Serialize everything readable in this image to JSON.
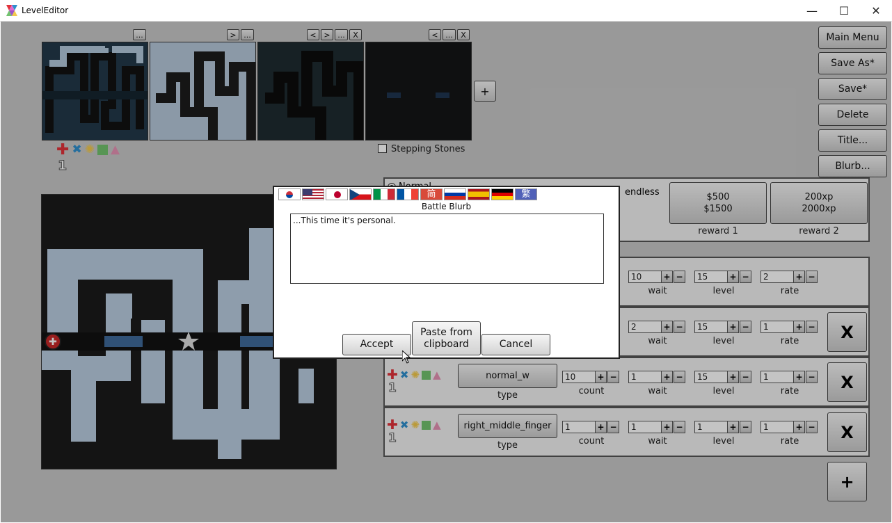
{
  "window": {
    "title": "LevelEditor",
    "minimize": "—",
    "maximize": "☐",
    "close": "✕"
  },
  "thumbs": {
    "buttons": [
      "...",
      ">",
      "...",
      "<",
      ">",
      "...",
      "X",
      "<",
      "...",
      "X"
    ],
    "add": "+",
    "stepping_stones": "Stepping Stones",
    "number": "1"
  },
  "sidebar": {
    "main_menu": "Main Menu",
    "save_as": "Save As*",
    "save": "Save*",
    "delete": "Delete",
    "title": "Title...",
    "blurb": "Blurb..."
  },
  "mode": {
    "normal": "Normal",
    "endless": "endless"
  },
  "rewards": {
    "reward1_value": "$500\n$1500",
    "reward1_label": "reward 1",
    "reward2_value": "200xp\n2000xp",
    "reward2_label": "reward 2"
  },
  "waves": [
    {
      "wait": "10",
      "level": "15",
      "rate": "2"
    },
    {
      "wait": "2",
      "level": "15",
      "rate": "1"
    },
    {
      "type": "normal_w",
      "count": "10",
      "wait": "1",
      "level": "15",
      "rate": "1"
    },
    {
      "type": "right_middle_finger",
      "count": "1",
      "wait": "1",
      "level": "1",
      "rate": "1"
    }
  ],
  "labels": {
    "type": "type",
    "count": "count",
    "wait": "wait",
    "level": "level",
    "rate": "rate",
    "remove": "X",
    "add_wave": "+",
    "plus": "+",
    "minus": "−"
  },
  "dialog": {
    "title": "Battle Blurb",
    "text": "...This time it's personal.",
    "accept": "Accept",
    "paste": "Paste from\nclipboard",
    "cancel": "Cancel",
    "cjk_simplified": "简",
    "cjk_traditional": "繁"
  },
  "colors": {
    "red": "#e2323a",
    "blue": "#2f8fce",
    "yellow": "#f2c94c",
    "green": "#72c26e",
    "pink": "#e592b4"
  }
}
